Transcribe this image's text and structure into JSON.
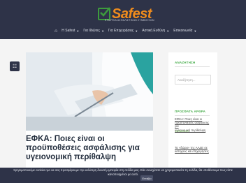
{
  "brand": {
    "name": "Safest",
    "tagline": "ΕΤΑΙΡΕΙΑ ΑΣΦΑΛΙΣΤΙΚΩΝ ΣΥΜΒΟΥΛΩΝ"
  },
  "nav": {
    "items": [
      {
        "label": "Η Safest"
      },
      {
        "label": "Για Ιδιώτες"
      },
      {
        "label": "Για Επιχειρήσεις"
      },
      {
        "label": "Αστική Ευθύνη"
      },
      {
        "label": "Επικοινωνία"
      }
    ]
  },
  "article": {
    "title_line1": "ΕΦΚΑ: Ποιες είναι οι",
    "title_line2": "προϋποθέσεις ασφάλισης για",
    "title_line3": "υγειονομική περίθαλψη"
  },
  "sidebar": {
    "search_title": "ΑΝΑΖΗΤΗΣΗ",
    "search_placeholder": "Αναζήτηση...",
    "recent_title": "ΠΡΟΣΦΑΤΑ ΑΡΘΡΑ",
    "recent_posts": [
      {
        "l1": "ΕΦΚΑ: Ποιες είναι οι",
        "l2": "προϋποθέσεις ασφάλισης για",
        "l3": "υγειονομική περίθαλψη",
        "date": "10/06/2019"
      },
      {
        "l1": "Τα «δώρα» της ΑΑΔΕ σε",
        "l2": "κατόχους και επιχειρήσεις",
        "l3": "",
        "date": ""
      }
    ]
  },
  "cookie": {
    "line1": "Χρησιμοποιούμε cookies για να σας προσφέρουμε την καλύτερη δυνατή εμπειρία στη σελίδα μας. Εάν συνεχίσετε να χρησιμοποιείτε τη σελίδα, θα υποθέσουμε πως είστε",
    "line2": "ικανοποιημένοι με αυτό.",
    "button": "Εντάξει"
  },
  "colors": {
    "header_bg": "#2e3348",
    "accent_green": "#4caf50",
    "brand_orange": "#ef8c1d"
  }
}
